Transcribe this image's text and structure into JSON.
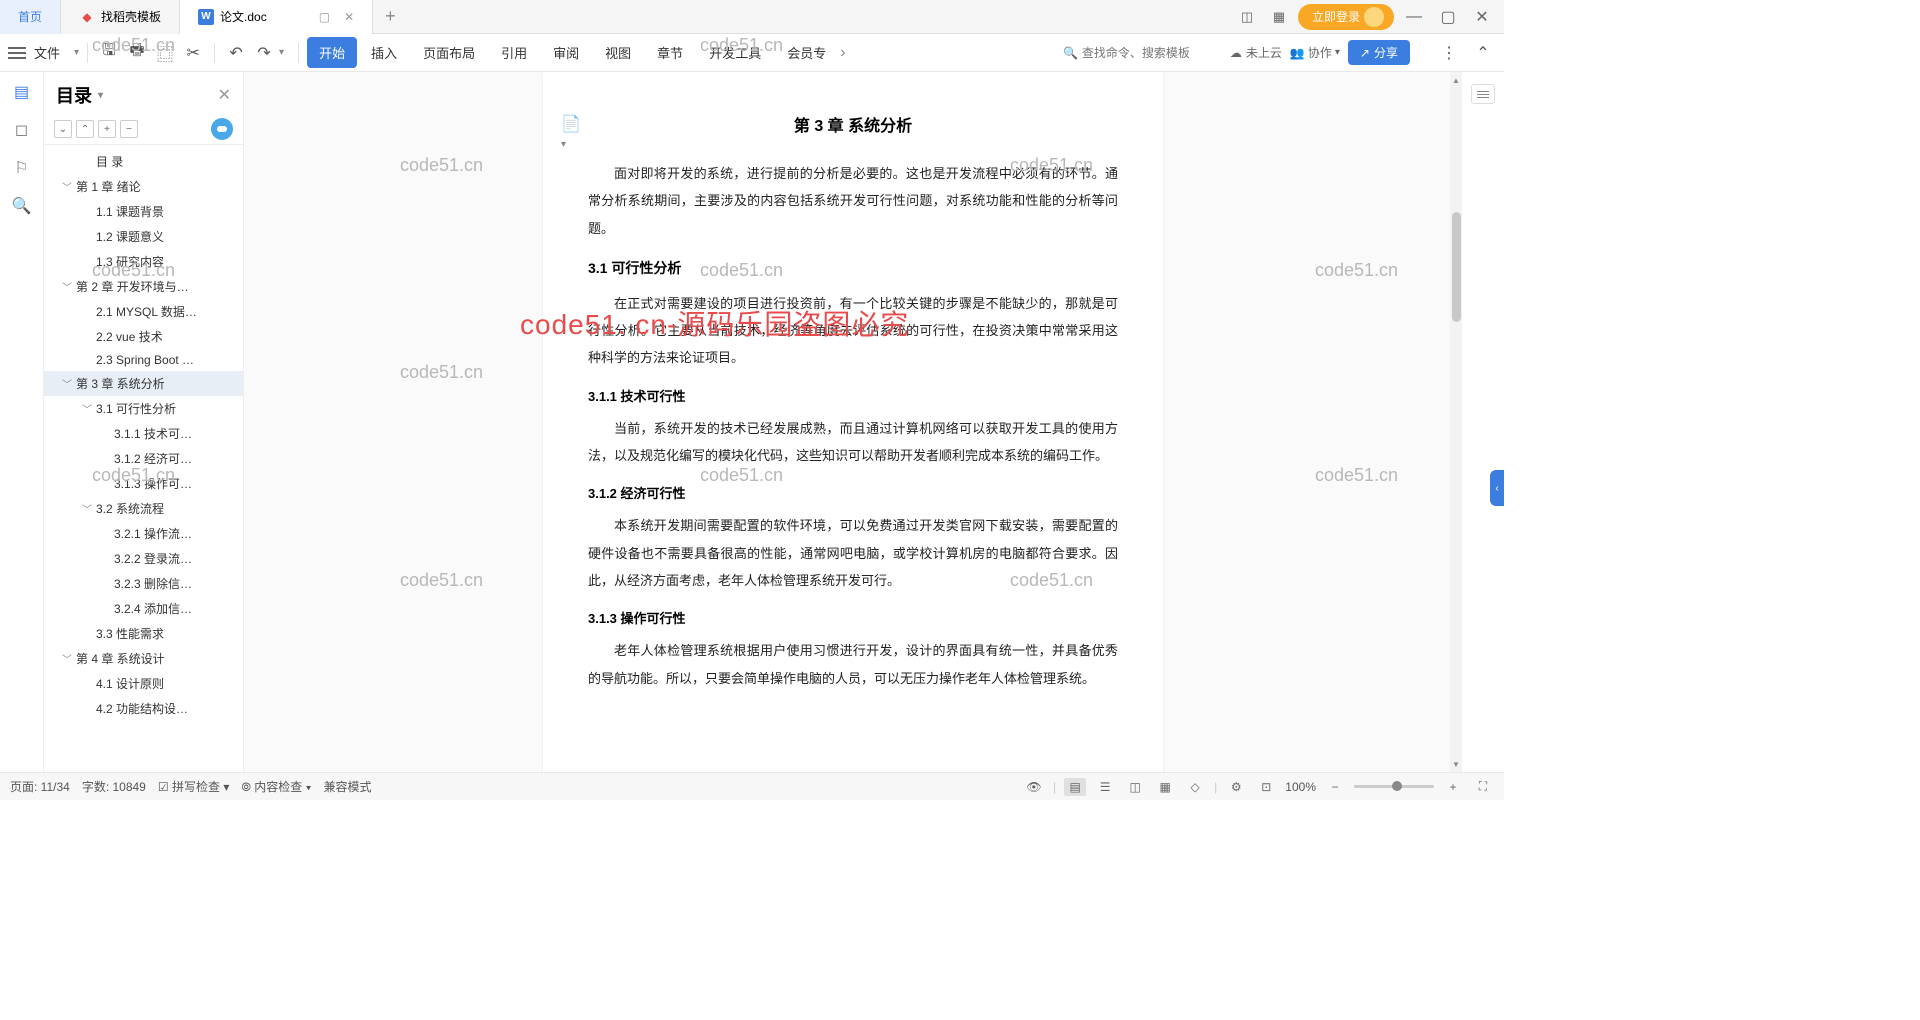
{
  "titlebar": {
    "tabs": {
      "home": "首页",
      "templates": "找稻壳模板",
      "active": "论文.doc"
    },
    "login": "立即登录"
  },
  "ribbon": {
    "file": "文件",
    "menu": {
      "start": "开始",
      "insert": "插入",
      "pagelayout": "页面布局",
      "reference": "引用",
      "review": "审阅",
      "view": "视图",
      "chapter": "章节",
      "devtools": "开发工具",
      "member": "会员专"
    },
    "search_placeholder": "查找命令、搜索模板",
    "cloud": "未上云",
    "collab": "协作",
    "share": "分享"
  },
  "outline": {
    "title": "目录",
    "items": [
      {
        "lv": 2,
        "text": "目  录",
        "chev": ""
      },
      {
        "lv": 1,
        "text": "第 1 章  绪论",
        "chev": "﹀"
      },
      {
        "lv": 2,
        "text": "1.1  课题背景",
        "chev": ""
      },
      {
        "lv": 2,
        "text": "1.2  课题意义",
        "chev": ""
      },
      {
        "lv": 2,
        "text": "1.3  研究内容",
        "chev": ""
      },
      {
        "lv": 1,
        "text": "第 2 章  开发环境与…",
        "chev": "﹀"
      },
      {
        "lv": 2,
        "text": "2.1 MYSQL 数据…",
        "chev": ""
      },
      {
        "lv": 2,
        "text": "2.2 vue 技术",
        "chev": ""
      },
      {
        "lv": 2,
        "text": "2.3 Spring Boot …",
        "chev": ""
      },
      {
        "lv": 1,
        "text": "第 3 章  系统分析",
        "chev": "﹀",
        "selected": true
      },
      {
        "lv": 2,
        "text": "3.1  可行性分析",
        "chev": "﹀"
      },
      {
        "lv": 3,
        "text": "3.1.1  技术可…",
        "chev": ""
      },
      {
        "lv": 3,
        "text": "3.1.2  经济可…",
        "chev": ""
      },
      {
        "lv": 3,
        "text": "3.1.3  操作可…",
        "chev": ""
      },
      {
        "lv": 2,
        "text": "3.2  系统流程",
        "chev": "﹀"
      },
      {
        "lv": 3,
        "text": "3.2.1  操作流…",
        "chev": ""
      },
      {
        "lv": 3,
        "text": "3.2.2  登录流…",
        "chev": ""
      },
      {
        "lv": 3,
        "text": "3.2.3  删除信…",
        "chev": ""
      },
      {
        "lv": 3,
        "text": "3.2.4  添加信…",
        "chev": ""
      },
      {
        "lv": 2,
        "text": "3.3  性能需求",
        "chev": ""
      },
      {
        "lv": 1,
        "text": "第 4 章  系统设计",
        "chev": "﹀"
      },
      {
        "lv": 2,
        "text": "4.1  设计原则",
        "chev": ""
      },
      {
        "lv": 2,
        "text": "4.2  功能结构设…",
        "chev": ""
      }
    ]
  },
  "doc": {
    "h1": "第 3 章  系统分析",
    "p1": "面对即将开发的系统，进行提前的分析是必要的。这也是开发流程中必须有的环节。通常分析系统期间，主要涉及的内容包括系统开发可行性问题，对系统功能和性能的分析等问题。",
    "h2_1": "3.1  可行性分析",
    "p2": "在正式对需要建设的项目进行投资前，有一个比较关键的步骤是不能缺少的，那就是可行性分析。它主要从当前技术，经济等角度去评估系统的可行性，在投资决策中常常采用这种科学的方法来论证项目。",
    "h3_1": "3.1.1  技术可行性",
    "p3": "当前，系统开发的技术已经发展成熟，而且通过计算机网络可以获取开发工具的使用方法，以及规范化编写的模块化代码，这些知识可以帮助开发者顺利完成本系统的编码工作。",
    "h3_2": "3.1.2  经济可行性",
    "p4": "本系统开发期间需要配置的软件环境，可以免费通过开发类官网下载安装，需要配置的硬件设备也不需要具备很高的性能，通常网吧电脑，或学校计算机房的电脑都符合要求。因此，从经济方面考虑，老年人体检管理系统开发可行。",
    "h3_3": "3.1.3  操作可行性",
    "p5": "老年人体检管理系统根据用户使用习惯进行开发，设计的界面具有统一性，并具备优秀的导航功能。所以，只要会简单操作电脑的人员，可以无压力操作老年人体检管理系统。"
  },
  "watermark": {
    "text": "code51.cn",
    "red": "code51. cn-源码乐园盗图必究"
  },
  "statusbar": {
    "page": "页面: 11/34",
    "words": "字数: 10849",
    "spell": "拼写检查",
    "content": "内容检查",
    "compat": "兼容模式",
    "zoom": "100%"
  }
}
